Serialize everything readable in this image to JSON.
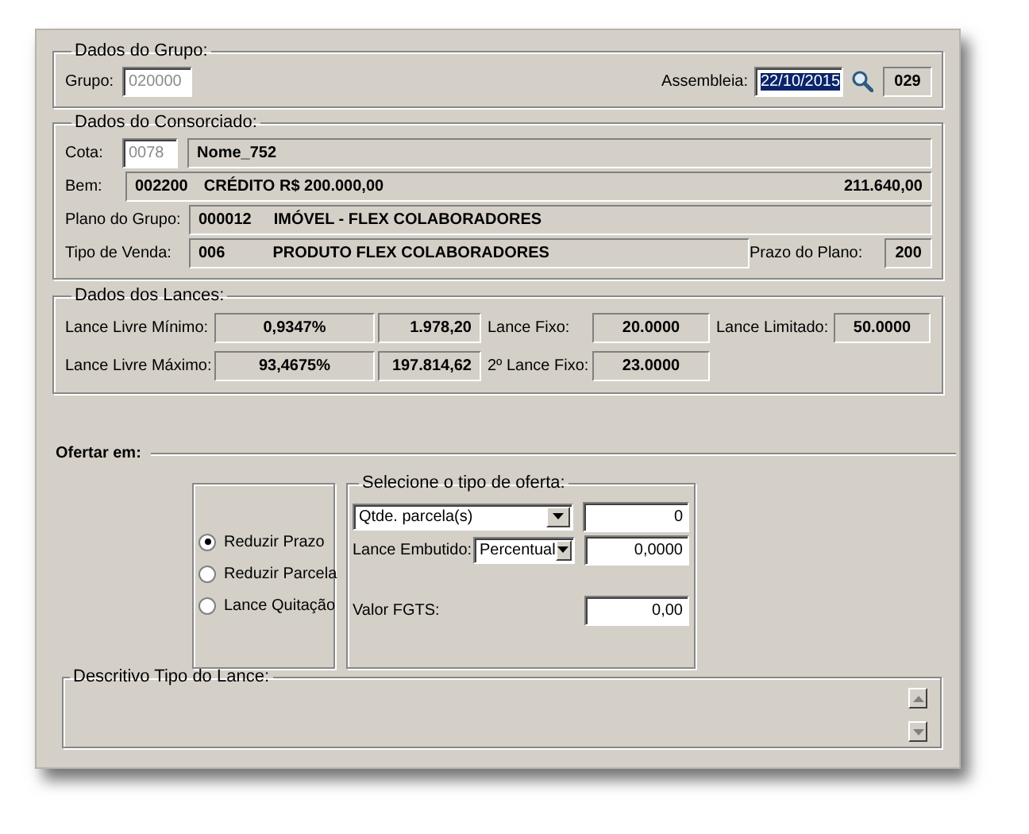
{
  "grupo_section": {
    "title": "Dados do Grupo:",
    "grupo": {
      "label": "Grupo:",
      "value": "020000",
      "disabled": true
    },
    "assembleia": {
      "label": "Assembleia:",
      "value": "22/10/2015",
      "selected": true
    },
    "assembleia_number": "029"
  },
  "consorciado": {
    "title": "Dados do Consorciado:",
    "cota": {
      "label": "Cota:",
      "value": "0078",
      "disabled": true
    },
    "nome": "Nome_752",
    "bem": {
      "label": "Bem:",
      "code": "002200",
      "description": "CRÉDITO R$ 200.000,00",
      "amount": "211.640,00"
    },
    "plano": {
      "label": "Plano do Grupo:",
      "code": "000012",
      "description": "IMÓVEL - FLEX COLABORADORES"
    },
    "tipo_venda": {
      "label": "Tipo de Venda:",
      "code": "006",
      "description": "PRODUTO FLEX COLABORADORES"
    },
    "prazo": {
      "label": "Prazo do Plano:",
      "value": "200"
    }
  },
  "lances": {
    "title": "Dados dos Lances:",
    "livre_minimo": {
      "label": "Lance Livre Mínimo:",
      "percent": "0,9347%",
      "amount": "1.978,20"
    },
    "livre_maximo": {
      "label": "Lance Livre Máximo:",
      "percent": "93,4675%",
      "amount": "197.814,62"
    },
    "fixo": {
      "label": "Lance Fixo:",
      "value": "20.0000"
    },
    "segundo_fixo": {
      "label": "2º Lance Fixo:",
      "value": "23.0000"
    },
    "limitado": {
      "label": "Lance Limitado:",
      "value": "50.0000"
    }
  },
  "ofertar": {
    "title": "Ofertar em:",
    "options": [
      {
        "label": "Reduzir Prazo",
        "selected": true
      },
      {
        "label": "Reduzir Parcela",
        "selected": false
      },
      {
        "label": "Lance Quitação",
        "selected": false
      }
    ],
    "tipo_oferta": {
      "title": "Selecione o tipo de oferta:",
      "type": "Qtde. parcela(s)",
      "quantity": "0",
      "embutido": {
        "label": "Lance Embutido:",
        "mode": "Percentual",
        "value": "0,0000"
      },
      "fgts": {
        "label": "Valor FGTS:",
        "value": "0,00"
      }
    }
  },
  "descritivo": {
    "title": "Descritivo Tipo do Lance:"
  }
}
